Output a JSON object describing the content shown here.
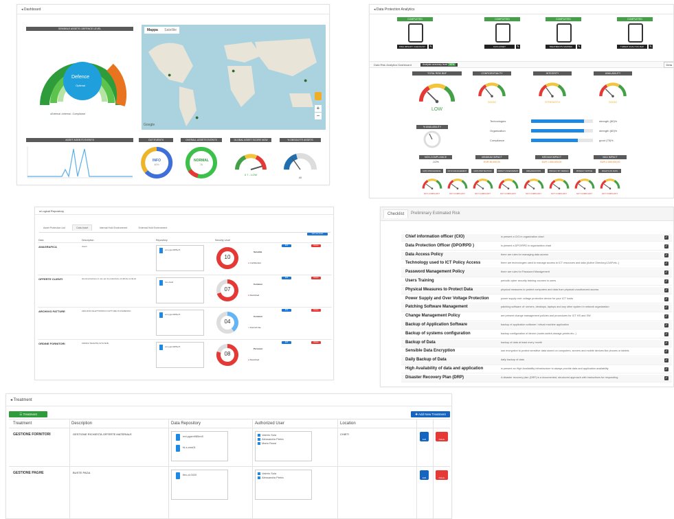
{
  "dashboard": {
    "title": "Dashboard",
    "sensitive_header": "SENSIBLE ASSETS: DEFENCE LEVEL",
    "gauge_label": "Defence",
    "gauge_sub": "Optimal",
    "legend": [
      "External",
      "Internal",
      "Compliance"
    ],
    "map_tabs": [
      "Mappa",
      "Satellite"
    ],
    "map_google": "Google",
    "bottom_headers": [
      "ASSET AGENTS EVENTS",
      "OUT EVENTS",
      "OVERALL ASSETS EVENTS",
      "GLOBAL ASSET SCORE NOW",
      "% OBSOLETE ASSETS"
    ],
    "donut1_text": "INFO",
    "donut1_sub": "40%",
    "donut2_text": "NORMAL",
    "donut2_sub": "76",
    "gauge3_text": "0.7 - LOW",
    "gauge4_text": "40"
  },
  "dpa": {
    "title": "Data Protection Analytics",
    "cards": [
      {
        "status": "Completed",
        "label": "Preliminary Checklist"
      },
      {
        "status": "Completed",
        "label": "Data Asset"
      },
      {
        "status": "Completed",
        "label": "Treatments Mapped"
      },
      {
        "status": "Completed",
        "label": "Threat Analysis Map"
      }
    ],
    "risk_title": "Data Risk Analytics Dashboard",
    "risk_badge": "Analysis accuracy level",
    "risk_pct": "90%",
    "risk_btn": "Deta",
    "gauge_headers": [
      "TOTAL RISK BNF",
      "Confidentiality",
      "Integrity",
      "Availability"
    ],
    "gauge_values": [
      "LOW",
      "GOOD",
      "STRENGTH",
      "GOOD"
    ],
    "bars": [
      {
        "label": "Technologies",
        "value": "strength (80)%",
        "pct": 0.85
      },
      {
        "label": "Organization",
        "value": "strength (80)%",
        "pct": 0.85
      },
      {
        "label": "Compliance",
        "value": "good (75)%",
        "pct": 0.75
      }
    ],
    "money_headers": [
      "Non-Compliance",
      "Minimum Impact",
      "Medium Impact",
      "Max Impact"
    ],
    "money_values": [
      "-0.2%",
      "EUR 36.000,00",
      "EUR 1.000.000,00",
      "EUR 2.000.000,00"
    ],
    "small_headers": [
      "Data Processing",
      "Data Management",
      "Data Protection",
      "Impact Assessment",
      "Organization",
      "Privacy by Design",
      "Privacy Notice",
      "Rights of Data Subjects"
    ],
    "small_value": "NOT COMPLIANT"
  },
  "repo": {
    "title": "Logical Repository",
    "tabs": [
      "Asset Protection List",
      "Data Asset",
      "Internal Hold Environment",
      "External Hold Environment"
    ],
    "add_btn": "Add new Asset",
    "cols": [
      "Data",
      "Description",
      "Repository",
      "Security Level"
    ],
    "rows": [
      {
        "name": "ANAGRAFICA",
        "desc": "clienti",
        "repo": "ent-pgsm985ec5",
        "score": "10",
        "category": "Sensible",
        "classification": "Confidential",
        "color": "#e53935",
        "pct": 1.0
      },
      {
        "name": "OFFERTE CLIENTI",
        "desc": "documentazione in uso per la produzione di offerte ai clienti",
        "repo": "fd-s-fsw0",
        "score": "07",
        "category": "Common",
        "classification": "Restricted",
        "color": "#e53935",
        "pct": 0.7
      },
      {
        "name": "ARCHIVIO FATTURE",
        "desc": "ARCHIVIO ELETTRONICO FATTURE IN INGRESSO",
        "repo": "ent-pgsm985ec5",
        "score": "04",
        "category": "Common",
        "classification": "Internal Use",
        "color": "#64b5f6",
        "pct": 0.4
      },
      {
        "name": "ORDINE FORNITORI",
        "desc": "ORDINI TRAMITE SITO B2B",
        "repo": "ent-pgsm985ec5",
        "score": "08",
        "category": "Personal",
        "classification": "Restricted",
        "color": "#e53935",
        "pct": 0.8
      }
    ],
    "edit": "Edit",
    "delete": "Delete"
  },
  "checklist": {
    "tabs": [
      "Checklist",
      "Preliminary Estimated Risk"
    ],
    "items": [
      {
        "t": "Chief information officer (CIO)",
        "d": "is present a CIO in organization chart"
      },
      {
        "t": "Data Protection Officer (DPO/RPD )",
        "d": "is present a DPO/RPD in organization chart"
      },
      {
        "t": "Data Access Policy",
        "d": "there are rules for managing data access"
      },
      {
        "t": "Technology used to ICT Policy Access",
        "d": "there are technologies used to manage access to ICT resources and data (Active Directory,LDAP,etc..)"
      },
      {
        "t": "Password Management Policy",
        "d": "there are rules for Password Management"
      },
      {
        "t": "Users Training",
        "d": "periodic cyber security training courses to users"
      },
      {
        "t": "Physical Measures to Protect Data",
        "d": "physical measures to protect computers and data from physical unauthorized access"
      },
      {
        "t": "Power Supply and Over Voltage Protection",
        "d": "power supply over voltage protection device for your ICT hosts"
      },
      {
        "t": "Patching Software Management",
        "d": "patching software of: servers, desktops, laptops and any other system in network organization"
      },
      {
        "t": "Change Management Policy",
        "d": "are present change management policies and procedures for ICT HS and SW"
      },
      {
        "t": "Backup of Application Software",
        "d": "backup of application software / virtual machine application"
      },
      {
        "t": "Backup of systems configuration",
        "d": "backup configuration of device (router,switch,storage,printer,etc..)"
      },
      {
        "t": "Backup of Data",
        "d": "backup of data at least every month"
      },
      {
        "t": "Sensible Data Encryption",
        "d": "use encryption to protect sensitive data stored on computers, servers and mobile devices like phones or tablets"
      },
      {
        "t": "Daily Backup of Data",
        "d": "daily backup of data"
      },
      {
        "t": "High Availability of data and application",
        "d": "is present an High Availability infrastructure to always provide data and application availability"
      },
      {
        "t": "Disaster Recovery Plan (DRP)",
        "d": "A disaster recovery plan (DRP) is a documented, structured approach with instructions for responding"
      }
    ]
  },
  "treatment": {
    "title": "Treatment",
    "green_btn": "Treatment",
    "add_btn": "Add New Treatment",
    "cols": [
      "Treatment",
      "Description",
      "Data Repository",
      "Authorized User",
      "Location"
    ],
    "rows": [
      {
        "name": "GESTIONE FORNITORI",
        "desc": "GESTIONE RICHIESTA OFFERTE MATERIALE",
        "repos": [
          "ent-pgsm985ec5",
          "fd-s-nas01"
        ],
        "users": [
          "Valerio Sola",
          "Alessandra Pietra",
          "Mario Rossi"
        ],
        "location": "CHIETI"
      },
      {
        "name": "GESTIONE PAGHE",
        "desc": "BUSTE PAGA",
        "repos": [
          "fleo-d-0020"
        ],
        "users": [
          "Valerio Sola",
          "Alessandra Pietra"
        ],
        "location": ""
      }
    ],
    "edit": "Edit",
    "delete": "Delete"
  }
}
